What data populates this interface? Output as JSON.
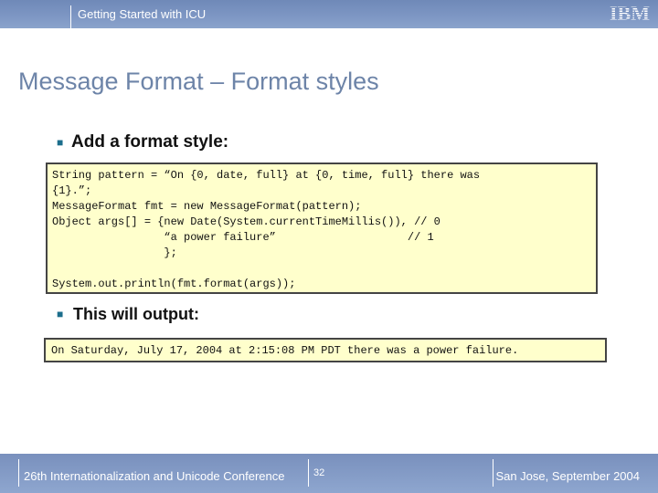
{
  "header": {
    "course_title": "Getting Started with ICU",
    "logo_text": "IBM"
  },
  "slide": {
    "title": "Message Format – Format styles",
    "bullet1": "Add a format style:",
    "code_lines": [
      "String pattern = “On {0, date, full} at {0, time, full} there was",
      "{1}.”;",
      "MessageFormat fmt = new MessageFormat(pattern);",
      "Object args[] = {new Date(System.currentTimeMillis()), // 0",
      "                 “a power failure”                    // 1",
      "                 };",
      "",
      "System.out.println(fmt.format(args));"
    ],
    "bullet2": "This will output:",
    "output": "On Saturday, July 17, 2004 at 2:15:08 PM PDT there was a power failure."
  },
  "footer": {
    "conference": "26th Internationalization and Unicode Conference",
    "page_number": "32",
    "location_date": "San Jose, September 2004"
  }
}
